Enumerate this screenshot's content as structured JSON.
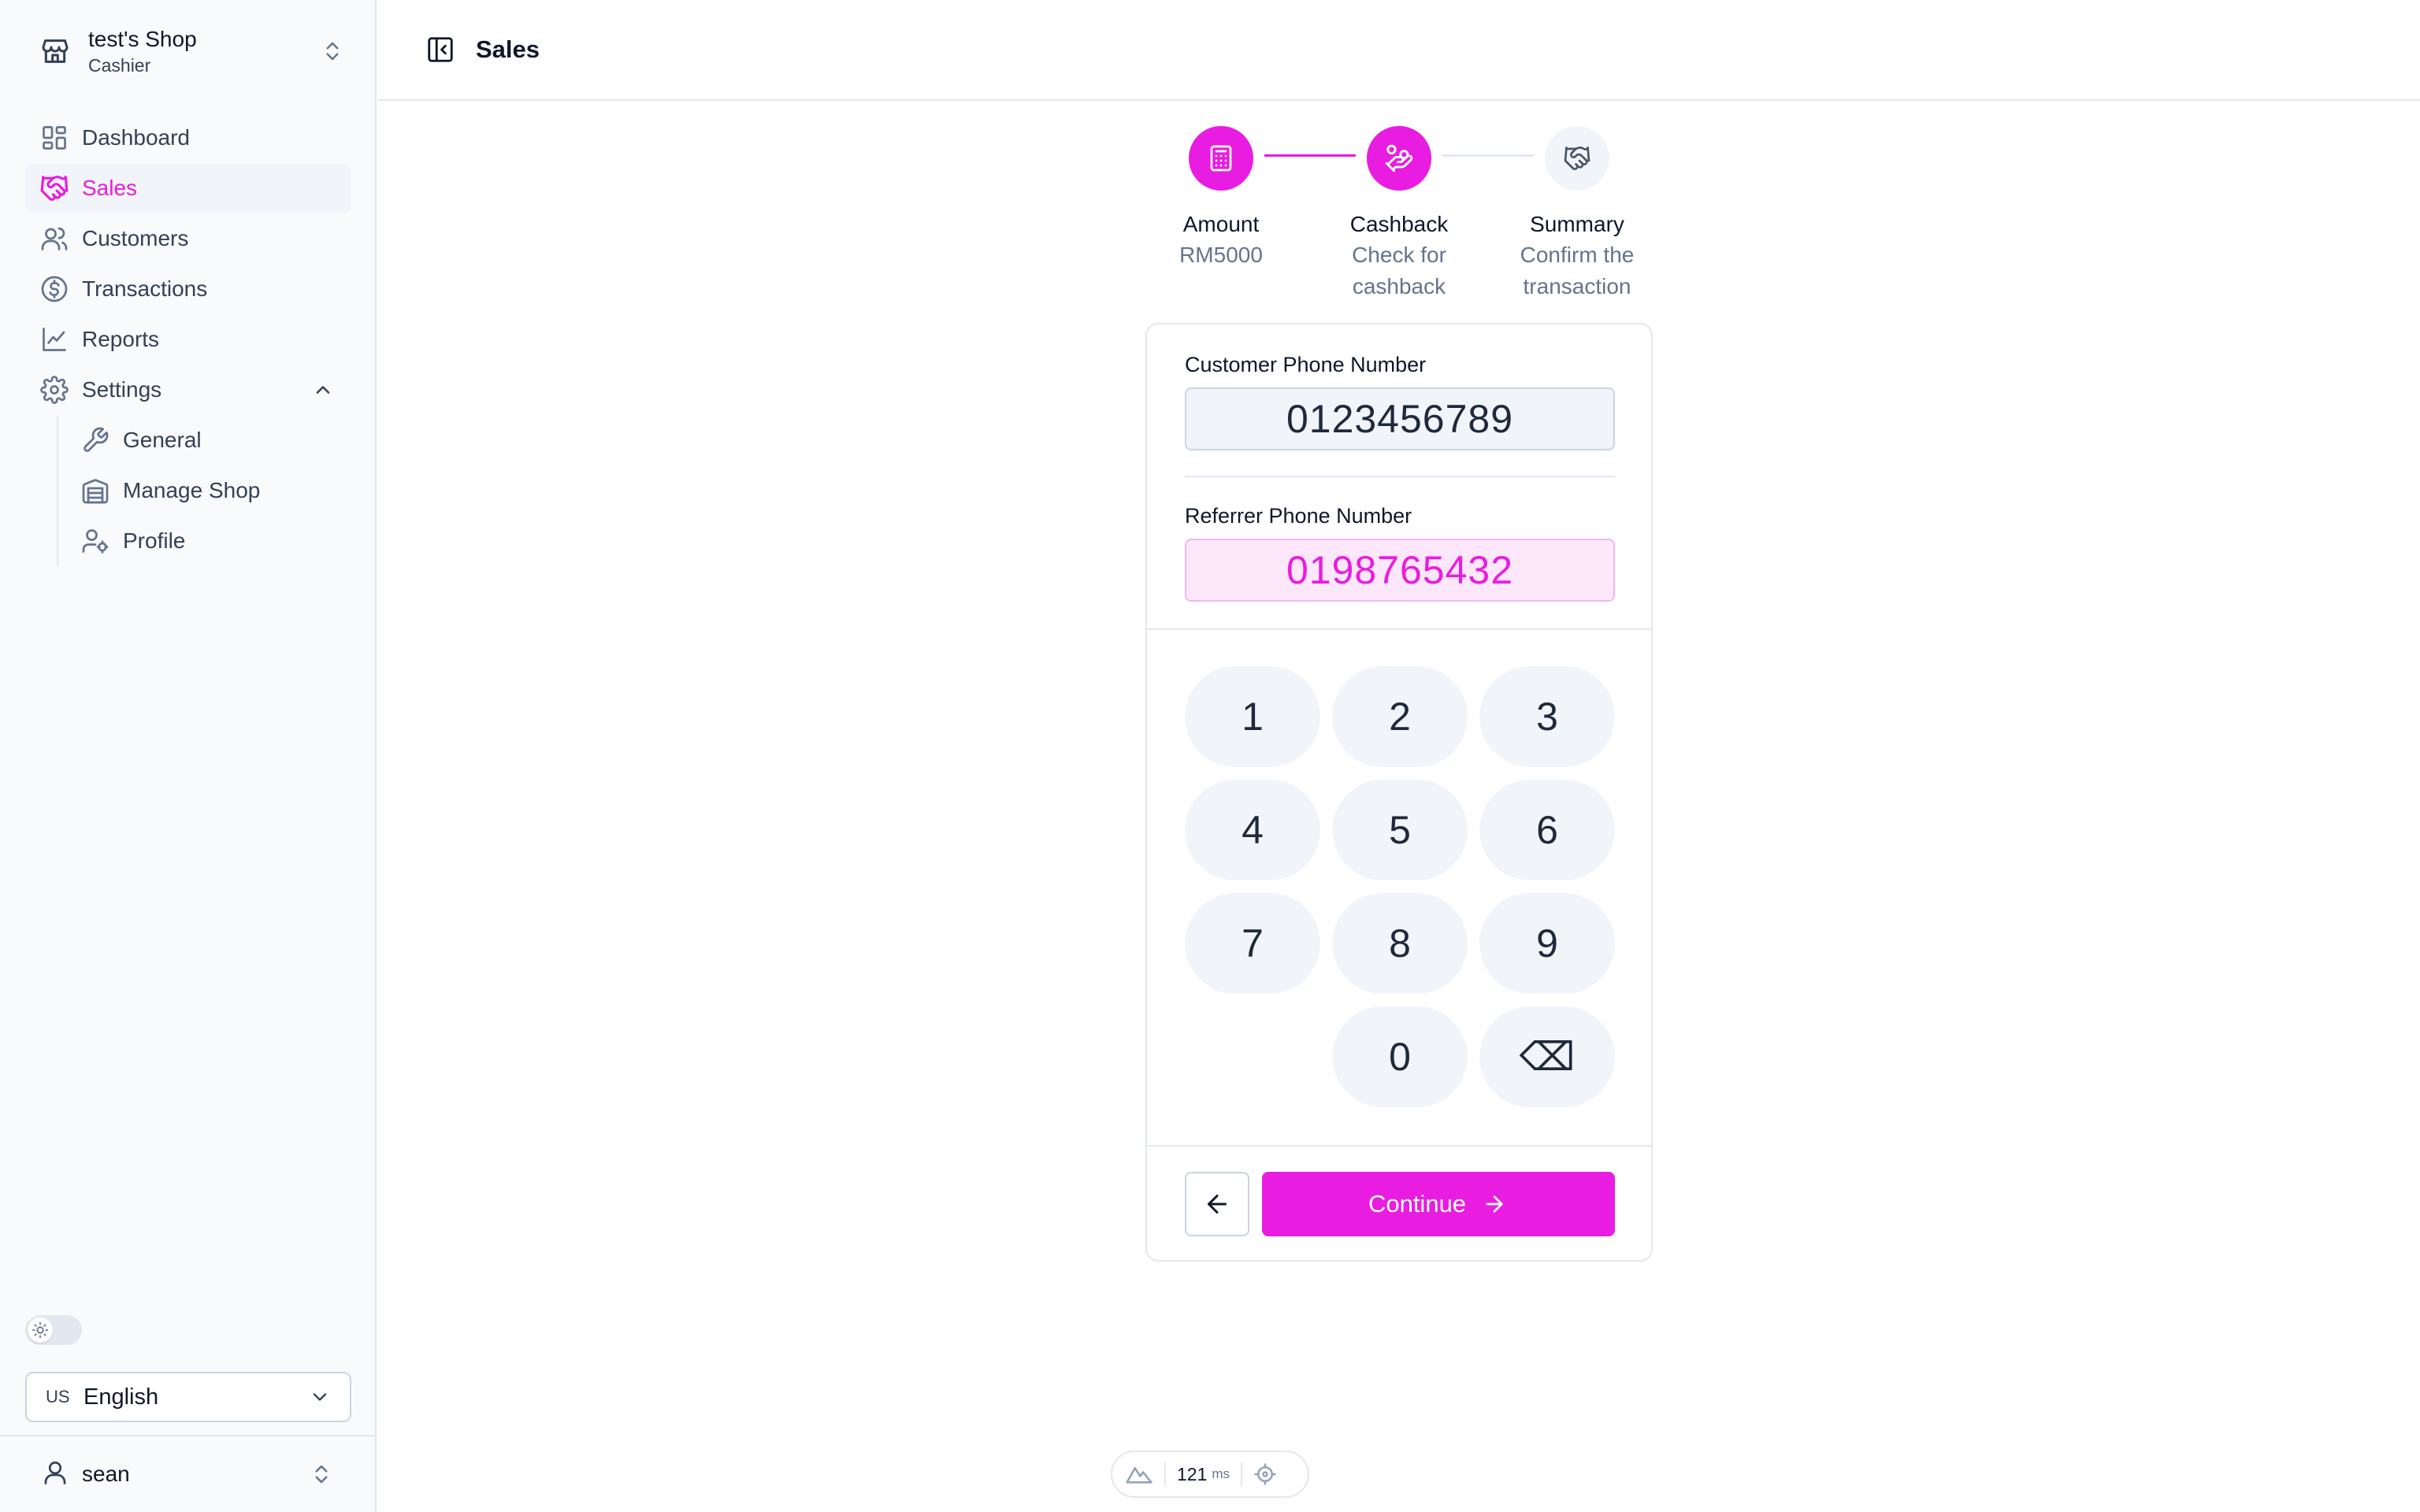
{
  "sidebar": {
    "shop_name": "test's Shop",
    "shop_role": "Cashier",
    "nav": [
      {
        "label": "Dashboard",
        "icon": "grid-icon"
      },
      {
        "label": "Sales",
        "icon": "handshake-icon",
        "active": true
      },
      {
        "label": "Customers",
        "icon": "users-icon"
      },
      {
        "label": "Transactions",
        "icon": "dollar-circle-icon"
      },
      {
        "label": "Reports",
        "icon": "chart-line-icon"
      },
      {
        "label": "Settings",
        "icon": "gear-icon",
        "expanded": true
      }
    ],
    "subnav": [
      {
        "label": "General",
        "icon": "wrench-icon"
      },
      {
        "label": "Manage Shop",
        "icon": "warehouse-icon"
      },
      {
        "label": "Profile",
        "icon": "user-cog-icon"
      }
    ],
    "language": {
      "code": "US",
      "name": "English"
    },
    "user": "sean"
  },
  "header": {
    "title": "Sales"
  },
  "stepper": [
    {
      "title": "Amount",
      "desc": "RM5000",
      "state": "done",
      "icon": "calculator-icon"
    },
    {
      "title": "Cashback",
      "desc": "Check for cashback",
      "state": "done",
      "icon": "hand-coins-icon"
    },
    {
      "title": "Summary",
      "desc": "Confirm the transaction",
      "state": "pending",
      "icon": "handshake-icon"
    }
  ],
  "form": {
    "customer_label": "Customer Phone Number",
    "customer_value": "0123456789",
    "referrer_label": "Referrer Phone Number",
    "referrer_value": "0198765432"
  },
  "keypad": [
    "1",
    "2",
    "3",
    "4",
    "5",
    "6",
    "7",
    "8",
    "9",
    "",
    "0",
    "⌫"
  ],
  "actions": {
    "continue_label": "Continue"
  },
  "devtools": {
    "ms_value": "121",
    "ms_unit": "ms"
  },
  "colors": {
    "accent": "#e91ce1",
    "muted": "#64748b",
    "border": "#e2e8f0"
  }
}
